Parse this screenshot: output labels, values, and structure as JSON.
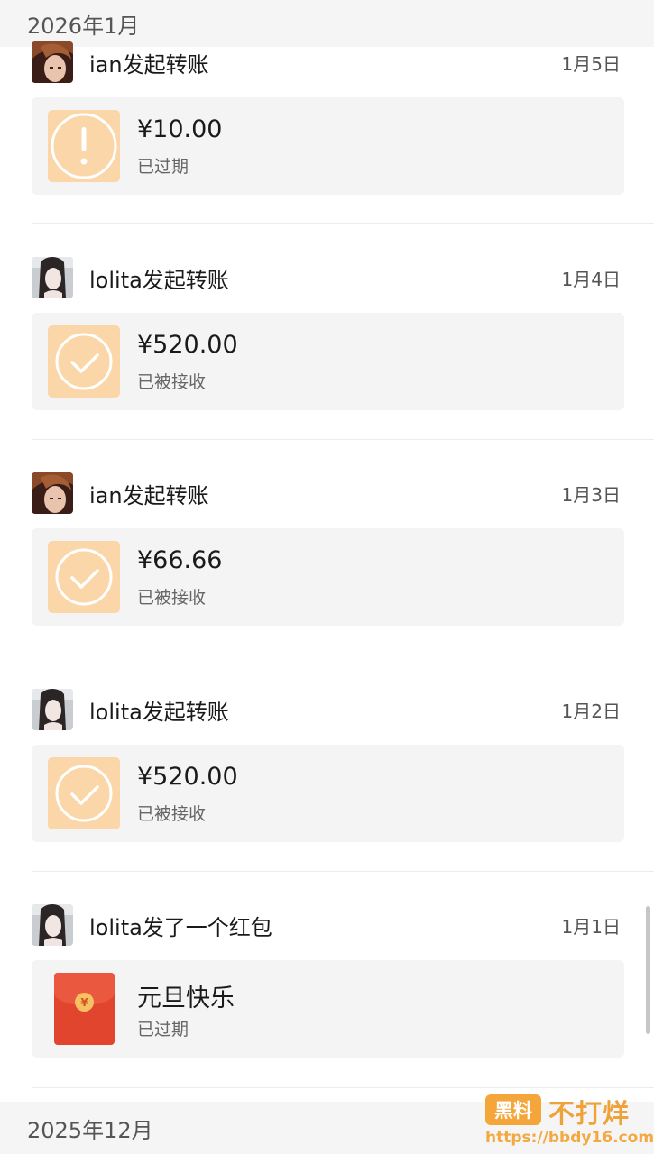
{
  "months": {
    "top": "2026年1月",
    "bottom": "2025年12月"
  },
  "records": [
    {
      "sender": "ian",
      "title": "ian发起转账",
      "date": "1月5日",
      "type": "transfer",
      "icon": "exclamation-icon",
      "amount": "¥10.00",
      "status": "已过期"
    },
    {
      "sender": "lolita",
      "title": "lolita发起转账",
      "date": "1月4日",
      "type": "transfer",
      "icon": "check-icon",
      "amount": "¥520.00",
      "status": "已被接收"
    },
    {
      "sender": "ian",
      "title": "ian发起转账",
      "date": "1月3日",
      "type": "transfer",
      "icon": "check-icon",
      "amount": "¥66.66",
      "status": "已被接收"
    },
    {
      "sender": "lolita",
      "title": "lolita发起转账",
      "date": "1月2日",
      "type": "transfer",
      "icon": "check-icon",
      "amount": "¥520.00",
      "status": "已被接收"
    },
    {
      "sender": "lolita",
      "title": "lolita发了一个红包",
      "date": "1月1日",
      "type": "red-packet",
      "icon": "red-packet-icon",
      "amount": "元旦快乐",
      "status": "已过期",
      "coin": "¥"
    }
  ],
  "colors": {
    "transfer_icon_bg": "#fbd6a9",
    "red_packet": "#e2452d",
    "card_bg": "#f4f4f4"
  },
  "watermark": {
    "badge": "黑料",
    "text": "不打烊",
    "url": "https://bbdy16.com"
  }
}
